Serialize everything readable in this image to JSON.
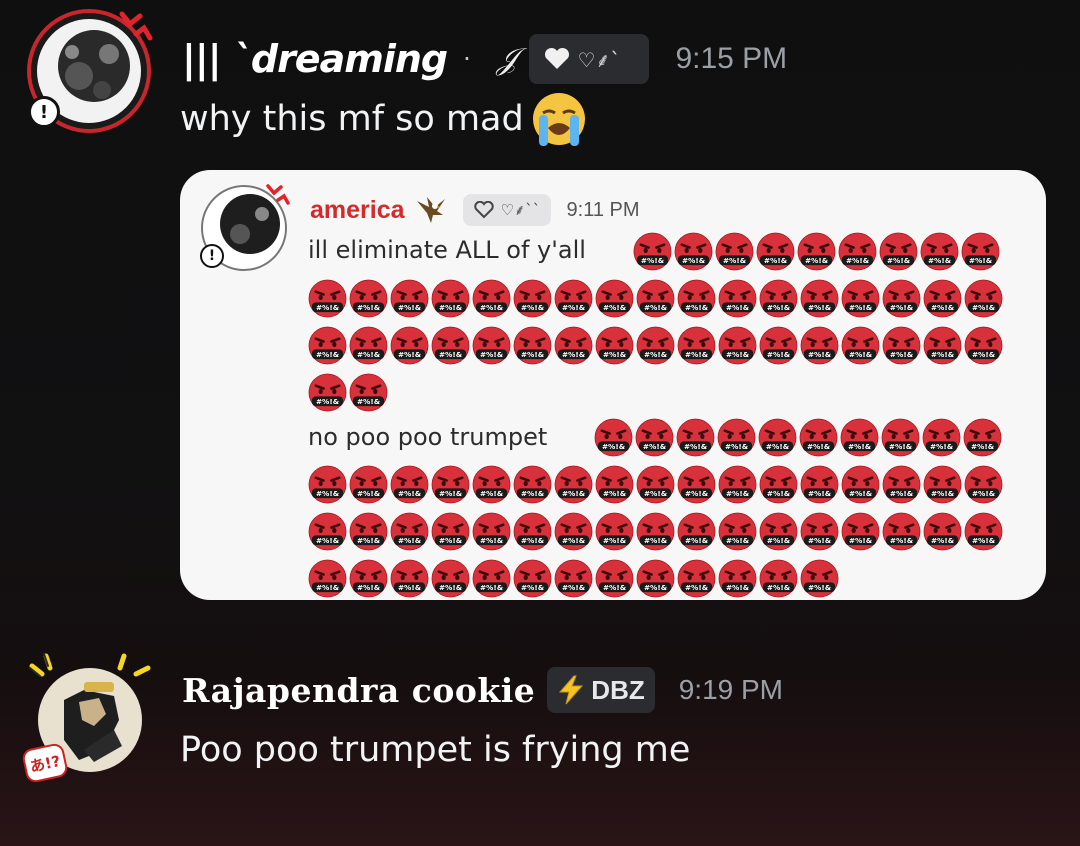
{
  "messages": [
    {
      "username": "|||  `dreaming",
      "decor_dot": "·",
      "feather_glyph": "𝒥",
      "tag_glyphs": "♡⸙ˋ",
      "timestamp": "9:15 PM",
      "text": "why this mf so mad",
      "emoji": "loudly-crying-face",
      "avatar_badge": "!"
    },
    {
      "username": "Rajapendra cookie",
      "tag": {
        "icon": "lightning-icon",
        "label": "DBZ"
      },
      "timestamp": "9:19 PM",
      "text": "Poo poo trumpet is frying me",
      "avatar_badge": "あ!?"
    }
  ],
  "quoted": {
    "username": "america",
    "name_color": "#d42a2a",
    "tag_glyphs": "♡⸙ˋˋ",
    "timestamp": "9:11 PM",
    "avatar_badge": "!",
    "paragraphs": [
      {
        "text": "ill eliminate ALL of y'all",
        "emoji": "face-with-symbols-on-mouth",
        "emoji_count": 45
      },
      {
        "text": "no poo poo trumpet",
        "emoji": "face-with-symbols-on-mouth",
        "emoji_count": 57
      }
    ],
    "emoji_symbols": "#%!&"
  },
  "colors": {
    "emoji_red": "#d8313b",
    "emoji_dark_red": "#a3191f",
    "timestamp_gray": "#9aa0a6",
    "embed_bg": "#f7f7f8"
  }
}
